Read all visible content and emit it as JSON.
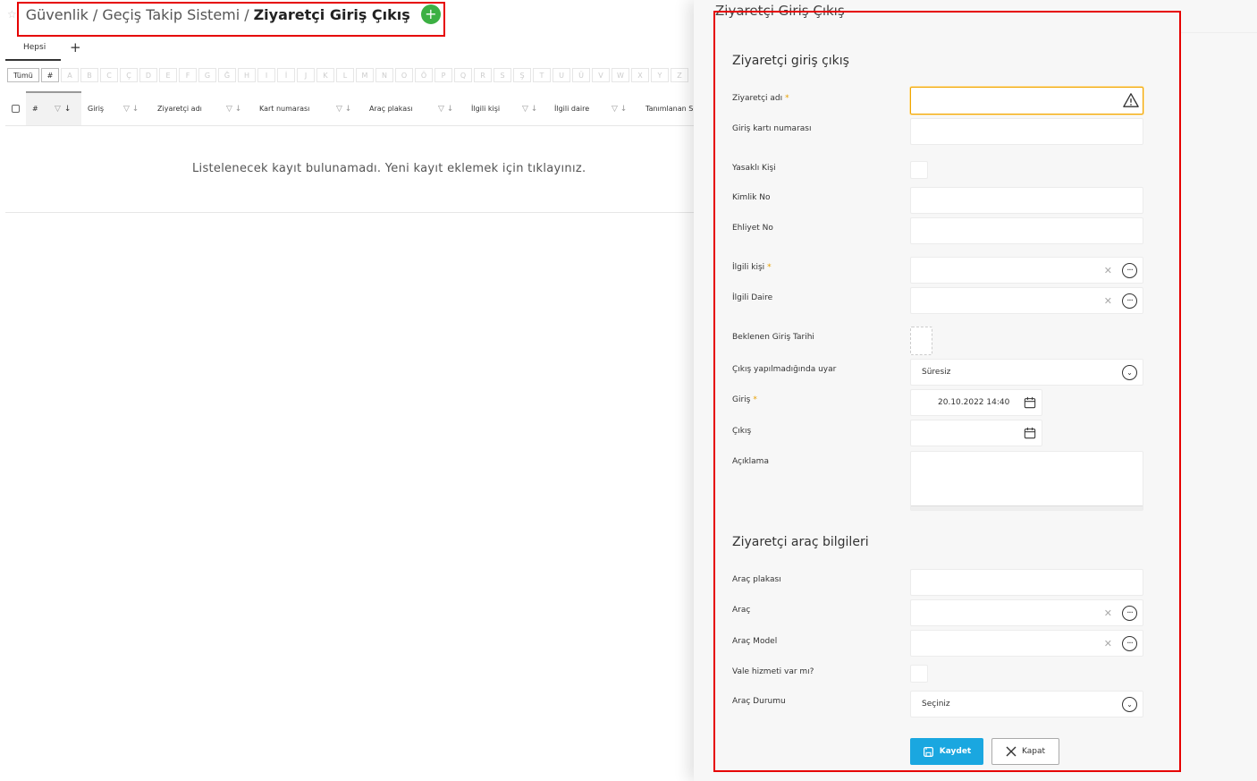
{
  "breadcrumb": {
    "part1": "Güvenlik",
    "part2": "Geçiş Takip Sistemi",
    "current": "Ziyaretçi Giriş Çıkış",
    "sep": "/"
  },
  "tabs": {
    "all": "Hepsi",
    "add": "+"
  },
  "alphabet": [
    "Tümü",
    "#",
    "A",
    "B",
    "C",
    "Ç",
    "D",
    "E",
    "F",
    "G",
    "Ğ",
    "H",
    "I",
    "İ",
    "J",
    "K",
    "L",
    "M",
    "N",
    "O",
    "Ö",
    "P",
    "Q",
    "R",
    "S",
    "Ş",
    "T",
    "U",
    "Ü",
    "V",
    "W",
    "X",
    "Y",
    "Z"
  ],
  "grid": {
    "hash": "#",
    "columns": [
      "Giriş",
      "Ziyaretçi adı",
      "Kart numarası",
      "Araç plakası",
      "İlgili kişi",
      "İlgili daire",
      "Tanımlanan S"
    ],
    "empty_message": "Listelenecek kayıt bulunamadı. Yeni kayıt eklemek için tıklayınız."
  },
  "panel": {
    "title": "Ziyaretçi Giriş Çıkış",
    "section1": "Ziyaretçi giriş çıkış",
    "section2": "Ziyaretçi araç bilgileri",
    "labels": {
      "visitor_name": "Ziyaretçi adı",
      "card_no": "Giriş kartı numarası",
      "banned": "Yasaklı Kişi",
      "id_no": "Kimlik No",
      "license_no": "Ehliyet No",
      "related_person": "İlgili kişi",
      "related_unit": "İlgili Daire",
      "expected_date": "Beklenen Giriş Tarihi",
      "warn_if_no_exit": "Çıkış yapılmadığında uyar",
      "entry": "Giriş",
      "exit": "Çıkış",
      "description": "Açıklama",
      "plate": "Araç plakası",
      "vehicle": "Araç",
      "vehicle_model": "Araç Model",
      "valet": "Vale hizmeti var mı?",
      "vehicle_status": "Araç Durumu"
    },
    "required_mark": "*",
    "values": {
      "warn_if_no_exit": "Süresiz",
      "entry": "20.10.2022 14:40",
      "vehicle_status": "Seçiniz"
    },
    "buttons": {
      "save": "Kaydet",
      "close": "Kapat"
    }
  }
}
